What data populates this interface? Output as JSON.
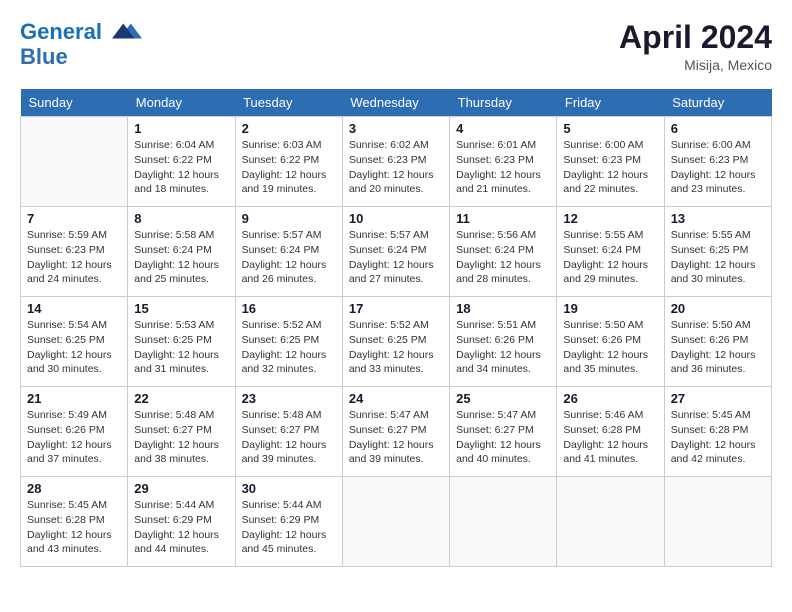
{
  "header": {
    "logo_line1": "General",
    "logo_line2": "Blue",
    "month_year": "April 2024",
    "location": "Misija, Mexico"
  },
  "weekdays": [
    "Sunday",
    "Monday",
    "Tuesday",
    "Wednesday",
    "Thursday",
    "Friday",
    "Saturday"
  ],
  "weeks": [
    [
      {
        "day": "",
        "sunrise": "",
        "sunset": "",
        "daylight": ""
      },
      {
        "day": "1",
        "sunrise": "Sunrise: 6:04 AM",
        "sunset": "Sunset: 6:22 PM",
        "daylight": "Daylight: 12 hours and 18 minutes."
      },
      {
        "day": "2",
        "sunrise": "Sunrise: 6:03 AM",
        "sunset": "Sunset: 6:22 PM",
        "daylight": "Daylight: 12 hours and 19 minutes."
      },
      {
        "day": "3",
        "sunrise": "Sunrise: 6:02 AM",
        "sunset": "Sunset: 6:23 PM",
        "daylight": "Daylight: 12 hours and 20 minutes."
      },
      {
        "day": "4",
        "sunrise": "Sunrise: 6:01 AM",
        "sunset": "Sunset: 6:23 PM",
        "daylight": "Daylight: 12 hours and 21 minutes."
      },
      {
        "day": "5",
        "sunrise": "Sunrise: 6:00 AM",
        "sunset": "Sunset: 6:23 PM",
        "daylight": "Daylight: 12 hours and 22 minutes."
      },
      {
        "day": "6",
        "sunrise": "Sunrise: 6:00 AM",
        "sunset": "Sunset: 6:23 PM",
        "daylight": "Daylight: 12 hours and 23 minutes."
      }
    ],
    [
      {
        "day": "7",
        "sunrise": "Sunrise: 5:59 AM",
        "sunset": "Sunset: 6:23 PM",
        "daylight": "Daylight: 12 hours and 24 minutes."
      },
      {
        "day": "8",
        "sunrise": "Sunrise: 5:58 AM",
        "sunset": "Sunset: 6:24 PM",
        "daylight": "Daylight: 12 hours and 25 minutes."
      },
      {
        "day": "9",
        "sunrise": "Sunrise: 5:57 AM",
        "sunset": "Sunset: 6:24 PM",
        "daylight": "Daylight: 12 hours and 26 minutes."
      },
      {
        "day": "10",
        "sunrise": "Sunrise: 5:57 AM",
        "sunset": "Sunset: 6:24 PM",
        "daylight": "Daylight: 12 hours and 27 minutes."
      },
      {
        "day": "11",
        "sunrise": "Sunrise: 5:56 AM",
        "sunset": "Sunset: 6:24 PM",
        "daylight": "Daylight: 12 hours and 28 minutes."
      },
      {
        "day": "12",
        "sunrise": "Sunrise: 5:55 AM",
        "sunset": "Sunset: 6:24 PM",
        "daylight": "Daylight: 12 hours and 29 minutes."
      },
      {
        "day": "13",
        "sunrise": "Sunrise: 5:55 AM",
        "sunset": "Sunset: 6:25 PM",
        "daylight": "Daylight: 12 hours and 30 minutes."
      }
    ],
    [
      {
        "day": "14",
        "sunrise": "Sunrise: 5:54 AM",
        "sunset": "Sunset: 6:25 PM",
        "daylight": "Daylight: 12 hours and 30 minutes."
      },
      {
        "day": "15",
        "sunrise": "Sunrise: 5:53 AM",
        "sunset": "Sunset: 6:25 PM",
        "daylight": "Daylight: 12 hours and 31 minutes."
      },
      {
        "day": "16",
        "sunrise": "Sunrise: 5:52 AM",
        "sunset": "Sunset: 6:25 PM",
        "daylight": "Daylight: 12 hours and 32 minutes."
      },
      {
        "day": "17",
        "sunrise": "Sunrise: 5:52 AM",
        "sunset": "Sunset: 6:25 PM",
        "daylight": "Daylight: 12 hours and 33 minutes."
      },
      {
        "day": "18",
        "sunrise": "Sunrise: 5:51 AM",
        "sunset": "Sunset: 6:26 PM",
        "daylight": "Daylight: 12 hours and 34 minutes."
      },
      {
        "day": "19",
        "sunrise": "Sunrise: 5:50 AM",
        "sunset": "Sunset: 6:26 PM",
        "daylight": "Daylight: 12 hours and 35 minutes."
      },
      {
        "day": "20",
        "sunrise": "Sunrise: 5:50 AM",
        "sunset": "Sunset: 6:26 PM",
        "daylight": "Daylight: 12 hours and 36 minutes."
      }
    ],
    [
      {
        "day": "21",
        "sunrise": "Sunrise: 5:49 AM",
        "sunset": "Sunset: 6:26 PM",
        "daylight": "Daylight: 12 hours and 37 minutes."
      },
      {
        "day": "22",
        "sunrise": "Sunrise: 5:48 AM",
        "sunset": "Sunset: 6:27 PM",
        "daylight": "Daylight: 12 hours and 38 minutes."
      },
      {
        "day": "23",
        "sunrise": "Sunrise: 5:48 AM",
        "sunset": "Sunset: 6:27 PM",
        "daylight": "Daylight: 12 hours and 39 minutes."
      },
      {
        "day": "24",
        "sunrise": "Sunrise: 5:47 AM",
        "sunset": "Sunset: 6:27 PM",
        "daylight": "Daylight: 12 hours and 39 minutes."
      },
      {
        "day": "25",
        "sunrise": "Sunrise: 5:47 AM",
        "sunset": "Sunset: 6:27 PM",
        "daylight": "Daylight: 12 hours and 40 minutes."
      },
      {
        "day": "26",
        "sunrise": "Sunrise: 5:46 AM",
        "sunset": "Sunset: 6:28 PM",
        "daylight": "Daylight: 12 hours and 41 minutes."
      },
      {
        "day": "27",
        "sunrise": "Sunrise: 5:45 AM",
        "sunset": "Sunset: 6:28 PM",
        "daylight": "Daylight: 12 hours and 42 minutes."
      }
    ],
    [
      {
        "day": "28",
        "sunrise": "Sunrise: 5:45 AM",
        "sunset": "Sunset: 6:28 PM",
        "daylight": "Daylight: 12 hours and 43 minutes."
      },
      {
        "day": "29",
        "sunrise": "Sunrise: 5:44 AM",
        "sunset": "Sunset: 6:29 PM",
        "daylight": "Daylight: 12 hours and 44 minutes."
      },
      {
        "day": "30",
        "sunrise": "Sunrise: 5:44 AM",
        "sunset": "Sunset: 6:29 PM",
        "daylight": "Daylight: 12 hours and 45 minutes."
      },
      {
        "day": "",
        "sunrise": "",
        "sunset": "",
        "daylight": ""
      },
      {
        "day": "",
        "sunrise": "",
        "sunset": "",
        "daylight": ""
      },
      {
        "day": "",
        "sunrise": "",
        "sunset": "",
        "daylight": ""
      },
      {
        "day": "",
        "sunrise": "",
        "sunset": "",
        "daylight": ""
      }
    ]
  ]
}
